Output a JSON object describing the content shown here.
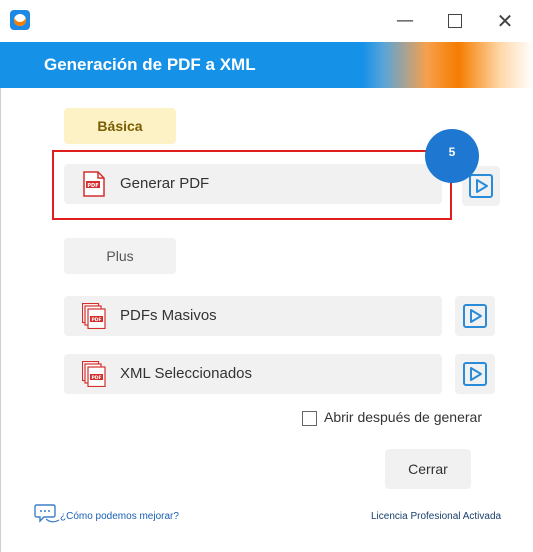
{
  "window": {
    "minimize_glyph": "—",
    "close_glyph": "✕"
  },
  "header": {
    "title": "Generación de PDF a XML"
  },
  "sections": {
    "basic_label": "Básica",
    "plus_label": "Plus"
  },
  "actions": {
    "generate_pdf": "Generar PDF",
    "mass_pdfs": "PDFs Masivos",
    "selected_xml": "XML Seleccionados"
  },
  "step_badge": "5",
  "options": {
    "open_after_label": "Abrir después de generar",
    "open_after_checked": false
  },
  "buttons": {
    "close_label": "Cerrar"
  },
  "footer": {
    "feedback_text": "¿Cómo podemos mejorar?",
    "license_text": "Licencia Profesional Activada"
  },
  "icons": {
    "app": "app-logo-icon",
    "pdf": "pdf-file-icon",
    "pdf_stack": "pdf-stack-icon",
    "play": "play-icon",
    "feedback": "chat-feedback-icon"
  },
  "colors": {
    "header_blue": "#1591e8",
    "header_orange": "#f57c00",
    "highlight_red": "#e01e1e",
    "badge_blue": "#1e78d2",
    "basic_bg": "#fdf2c5"
  }
}
